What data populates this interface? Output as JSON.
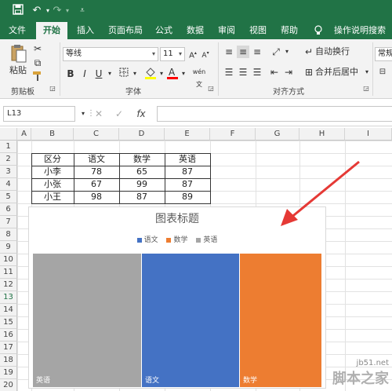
{
  "ribbon_tabs": [
    "文件",
    "开始",
    "插入",
    "页面布局",
    "公式",
    "数据",
    "审阅",
    "视图",
    "帮助",
    "操作说明搜索"
  ],
  "active_tab": "开始",
  "ribbon": {
    "paste_label": "粘贴",
    "font_name": "等线",
    "font_size": "11",
    "bold": "B",
    "italic": "I",
    "underline": "U",
    "wrap_text": "自动换行",
    "merge_center": "合并后居中",
    "number_format": "常规",
    "groups": [
      "剪贴板",
      "字体",
      "对齐方式"
    ]
  },
  "formula_bar": {
    "name_box": "L13",
    "fx": "fx",
    "cancel": "✕",
    "confirm": "✓"
  },
  "columns": [
    "A",
    "B",
    "C",
    "D",
    "E",
    "F",
    "G",
    "H",
    "I"
  ],
  "rows": [
    "1",
    "2",
    "3",
    "4",
    "5",
    "6",
    "7",
    "8",
    "9",
    "10",
    "11",
    "12",
    "13",
    "14",
    "15",
    "16",
    "17",
    "18",
    "19",
    "20"
  ],
  "selected_row": "13",
  "table": {
    "header": [
      "区分",
      "语文",
      "数学",
      "英语"
    ],
    "rows": [
      [
        "小李",
        "78",
        "65",
        "87"
      ],
      [
        "小张",
        "67",
        "99",
        "87"
      ],
      [
        "小王",
        "98",
        "87",
        "89"
      ]
    ]
  },
  "chart_data": {
    "type": "bar",
    "title": "图表标题",
    "legend": [
      "语文",
      "数学",
      "英语"
    ],
    "legend_colors": [
      "#4472c4",
      "#ed7d31",
      "#a5a5a5"
    ],
    "categories": [
      "英语",
      "语文",
      "数学"
    ],
    "series": [
      {
        "name": "英语",
        "color": "#a5a5a5"
      },
      {
        "name": "语文",
        "color": "#4472c4"
      },
      {
        "name": "数学",
        "color": "#ed7d31"
      }
    ]
  },
  "watermark": {
    "url": "jb51.net",
    "text": "脚本之家"
  }
}
